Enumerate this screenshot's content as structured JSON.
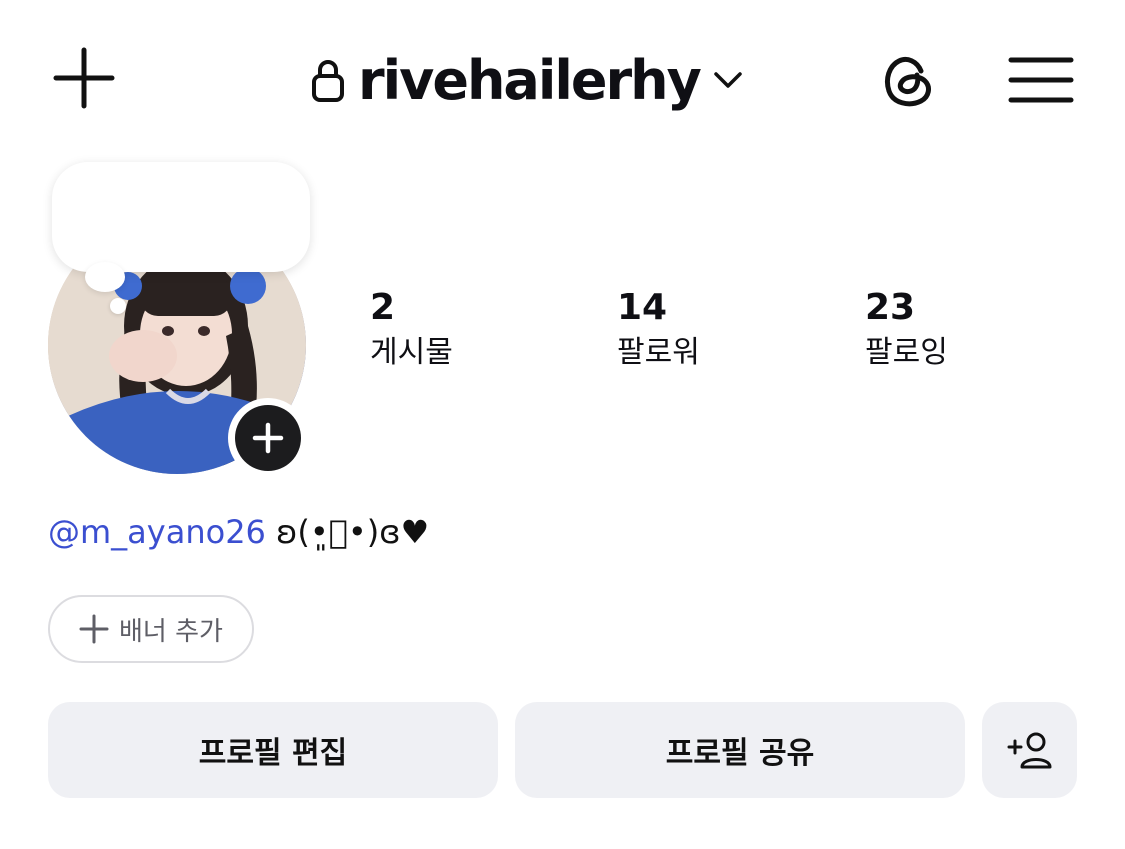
{
  "header": {
    "username": "rivehailerhy"
  },
  "icons": {
    "new_post": "plus-icon",
    "lock": "lock-icon",
    "dropdown": "chevron-down-icon",
    "threads": "threads-icon",
    "menu": "hamburger-menu-icon",
    "add_story": "plus-icon",
    "discover_people": "add-person-icon"
  },
  "stats": [
    {
      "value": "2",
      "label": "게시물"
    },
    {
      "value": "14",
      "label": "팔로워"
    },
    {
      "value": "23",
      "label": "팔로잉"
    }
  ],
  "bio": {
    "mention": "@m_ayano26",
    "text": " ʚ(•͈ᷦ•)ɞ♥"
  },
  "banner": {
    "label": "배너 추가"
  },
  "actions": {
    "edit_profile": "프로필 편집",
    "share_profile": "프로필 공유"
  },
  "colors": {
    "mention": "#3b4fd0",
    "button_bg": "#eff0f4",
    "text": "#0f0f14"
  }
}
